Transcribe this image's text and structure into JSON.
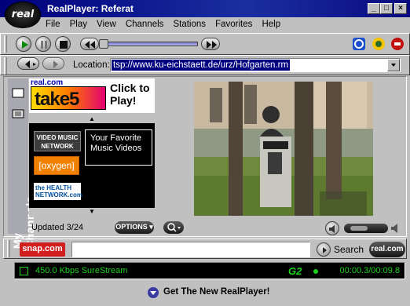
{
  "window": {
    "title": "RealPlayer: Referat",
    "logo_text": "real"
  },
  "menu": [
    "File",
    "Play",
    "View",
    "Channels",
    "Stations",
    "Favorites",
    "Help"
  ],
  "location": {
    "label": "Location:",
    "value": "tsp://www.ku-eichstaett.de/urz/Hofgarten.rm"
  },
  "channels": {
    "tab_label": "My Channels",
    "ad": {
      "brand": "real.com",
      "take5": "take5",
      "cta": "Click to Play!"
    },
    "logos": {
      "video_music": "VIDEO MUSIC NETWORK",
      "oxygen": "[oxygen]",
      "health": "the HEALTH NETWORK.com"
    },
    "featured_text": "Your Favorite Music Videos",
    "updated": "Updated 3/24",
    "options_label": "OPTIONS"
  },
  "playback": {
    "seek_fraction": 0.0,
    "volume_fraction": 0.55
  },
  "snap": {
    "logo": "snap.com",
    "search_placeholder": "",
    "search_label": "Search",
    "realcom": "real.com"
  },
  "status": {
    "bandwidth": "450.0 Kbps SureStream",
    "codec": "G2",
    "time": "00:00.3/00:09.8"
  },
  "promo": {
    "label": "Get The New RealPlayer!"
  },
  "colors": {
    "title_bar": "#00007b",
    "status_text": "#1bd11b",
    "selection": "#000080"
  }
}
